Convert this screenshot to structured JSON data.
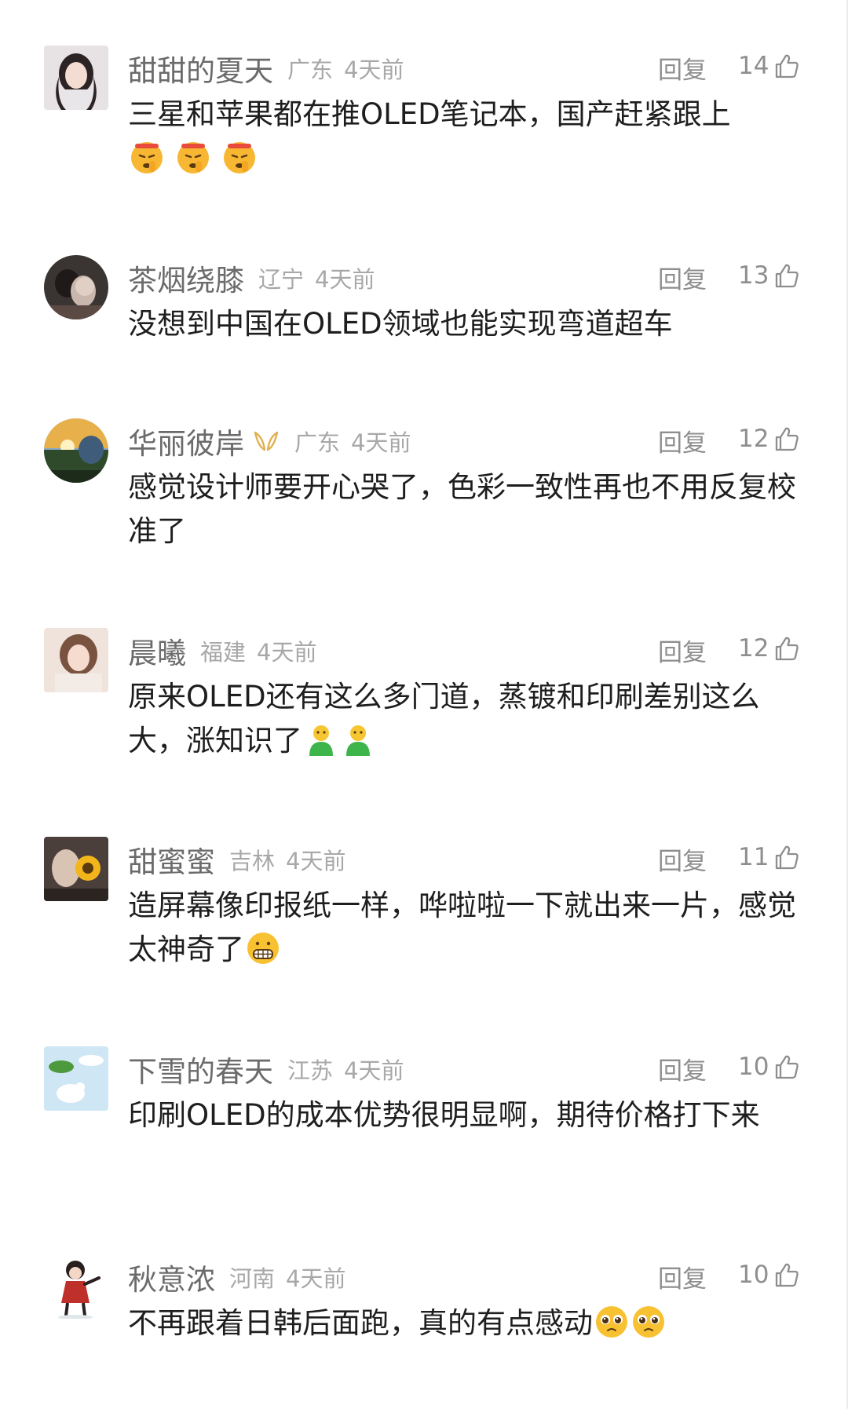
{
  "reply_label": "回复",
  "colors": {
    "username": "#6b6b6b",
    "meta": "#a8a8a8",
    "action": "#8e8e8e",
    "body_text": "#1e1e1e",
    "vip_gold": "#e0b052"
  },
  "comments": [
    {
      "username": "甜甜的夏天",
      "location": "广东",
      "time": "4天前",
      "likes": "14",
      "text": "三星和苹果都在推OLED笔记本，国产赶紧跟上",
      "emojis": [
        "shushing-face",
        "shushing-face",
        "shushing-face"
      ],
      "avatar": "avatar-girl-photo",
      "vip": false
    },
    {
      "username": "茶烟绕膝",
      "location": "辽宁",
      "time": "4天前",
      "likes": "13",
      "text": "没想到中国在OLED领域也能实现弯道超车",
      "emojis": [],
      "avatar": "avatar-couple-photo",
      "vip": false
    },
    {
      "username": "华丽彼岸",
      "location": "广东",
      "time": "4天前",
      "likes": "12",
      "text": "感觉设计师要开心哭了，色彩一致性再也不用反复校准了",
      "emojis": [],
      "avatar": "avatar-sunset-photo",
      "vip": true
    },
    {
      "username": "晨曦",
      "location": "福建",
      "time": "4天前",
      "likes": "12",
      "text": "原来OLED还有这么多门道，蒸镀和印刷差别这么大，涨知识了",
      "emojis": [
        "green-person",
        "green-person"
      ],
      "avatar": "avatar-woman-photo",
      "vip": false
    },
    {
      "username": "甜蜜蜜",
      "location": "吉林",
      "time": "4天前",
      "likes": "11",
      "text": "造屏幕像印报纸一样，哗啦啦一下就出来一片，感觉太神奇了",
      "emojis": [
        "grimacing-face"
      ],
      "avatar": "avatar-sunflower-photo",
      "vip": false
    },
    {
      "username": "下雪的春天",
      "location": "江苏",
      "time": "4天前",
      "likes": "10",
      "text": "印刷OLED的成本优势很明显啊，期待价格打下来",
      "emojis": [],
      "avatar": "avatar-sky-bird-photo",
      "vip": false
    },
    {
      "username": "秋意浓",
      "location": "河南",
      "time": "4天前",
      "likes": "10",
      "text": "不再跟着日韩后面跑，真的有点感动",
      "emojis": [
        "pleading-face",
        "pleading-face"
      ],
      "avatar": "avatar-cartoon-girl",
      "vip": false
    }
  ]
}
